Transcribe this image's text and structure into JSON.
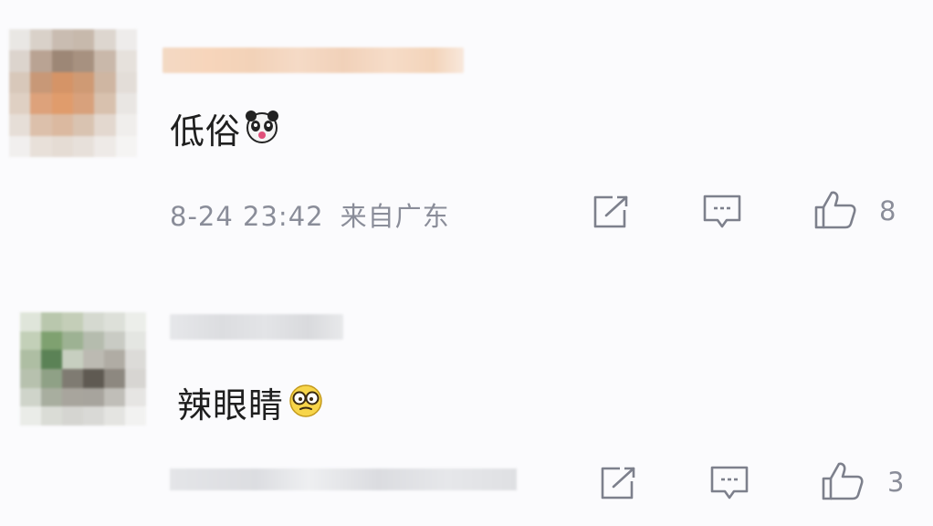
{
  "comments": [
    {
      "text": "低俗",
      "emoji": "panda-face-emoji",
      "timestamp": "8-24 23:42",
      "location": "来自广东",
      "share_icon": "share-icon",
      "reply_icon": "comment-icon",
      "like_icon": "thumbs-up-icon",
      "like_count": "8"
    },
    {
      "text": "辣眼睛",
      "emoji": "glasses-face-emoji",
      "share_icon": "share-icon",
      "reply_icon": "comment-icon",
      "like_icon": "thumbs-up-icon",
      "like_count": "3"
    }
  ],
  "colors": {
    "background": "#fbfbfd",
    "text": "#1f1f1f",
    "meta_text": "#8a8d99",
    "icon": "#7d808c"
  }
}
